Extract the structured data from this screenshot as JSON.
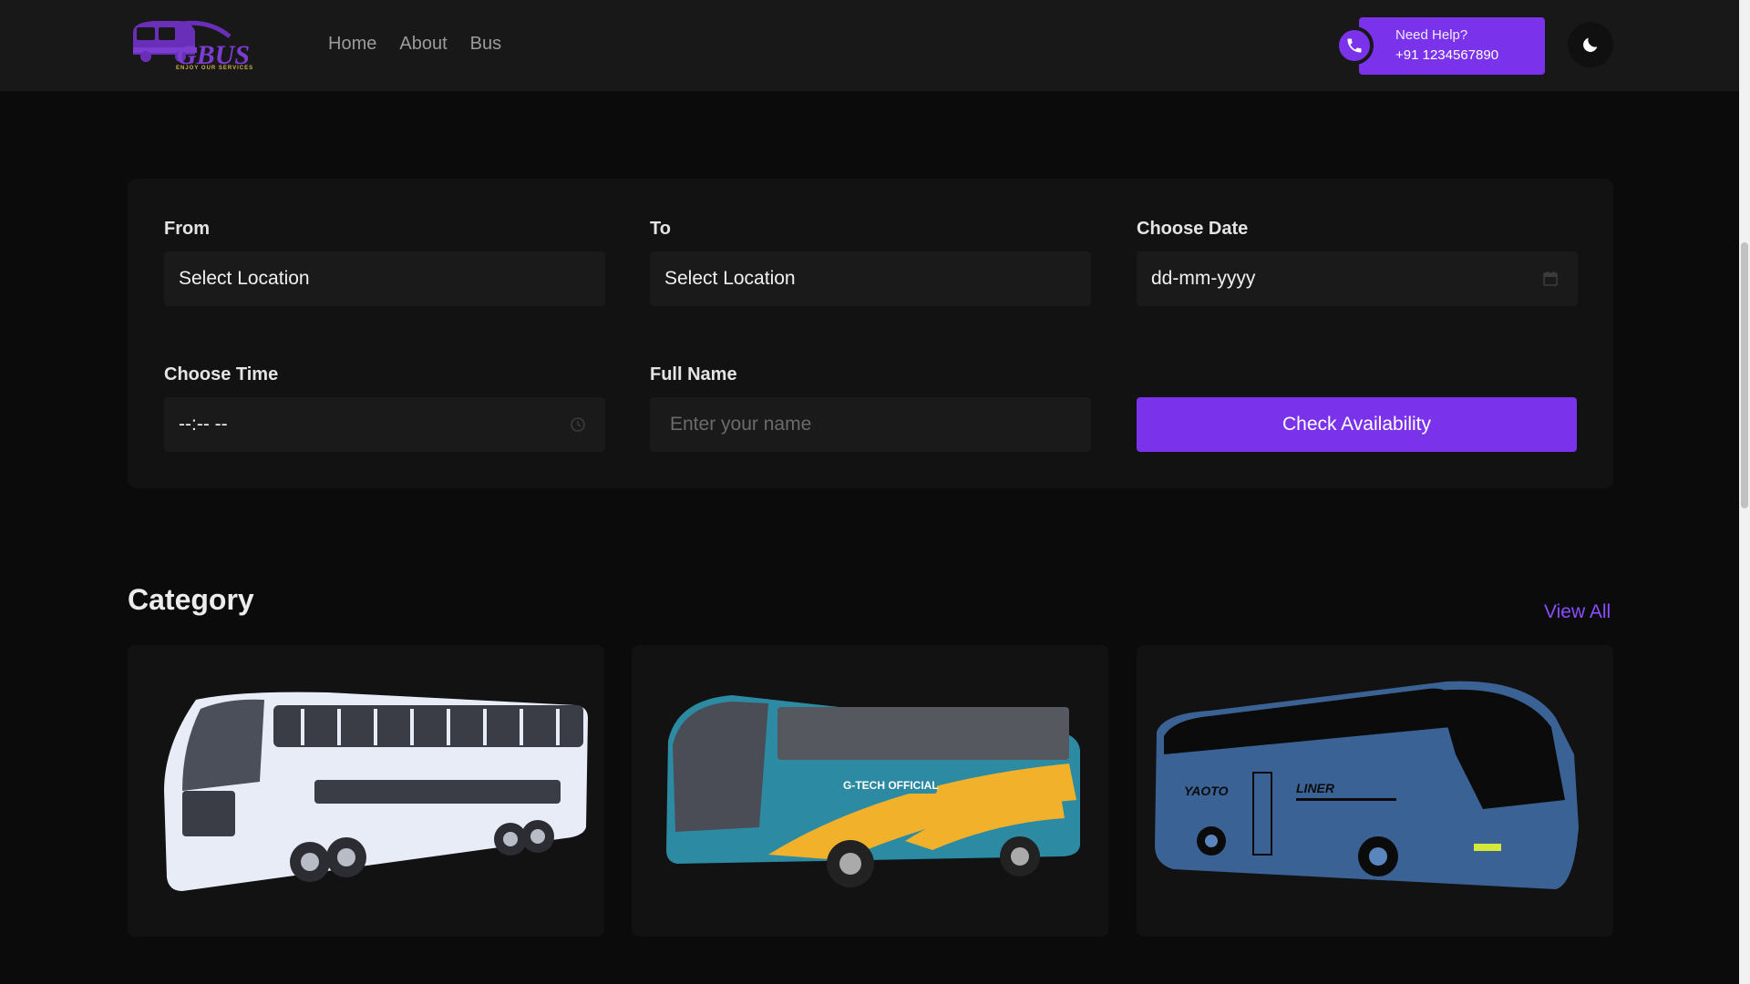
{
  "header": {
    "logo_text": "GBUS",
    "logo_tagline": "ENJOY OUR SERVICES",
    "nav": [
      "Home",
      "About",
      "Bus"
    ],
    "help_title": "Need Help?",
    "help_phone": "+91 1234567890",
    "theme_toggle_icon": "moon-icon"
  },
  "booking_form": {
    "from": {
      "label": "From",
      "value": "Select Location"
    },
    "to": {
      "label": "To",
      "value": "Select Location"
    },
    "date": {
      "label": "Choose Date",
      "value": "dd-mm-yyyy",
      "icon": "calendar-icon"
    },
    "time": {
      "label": "Choose Time",
      "value": "--:-- --",
      "icon": "clock-icon"
    },
    "name": {
      "label": "Full Name",
      "placeholder": "Enter your name"
    },
    "submit_label": "Check Availability"
  },
  "category": {
    "title": "Category",
    "view_all": "View All",
    "cards": [
      {
        "image": "double-decker-bus",
        "text": ""
      },
      {
        "image": "tourist-bus",
        "text": "G-TECH OFFICIAL"
      },
      {
        "image": "liner-bus",
        "text_left": "YAOTO",
        "text_right": "LINER"
      }
    ]
  },
  "colors": {
    "accent": "#7a33eb",
    "link": "#8b4dff",
    "background": "#0b0b0b",
    "header": "#181818",
    "card": "#121212",
    "input": "#1a1a1a"
  }
}
